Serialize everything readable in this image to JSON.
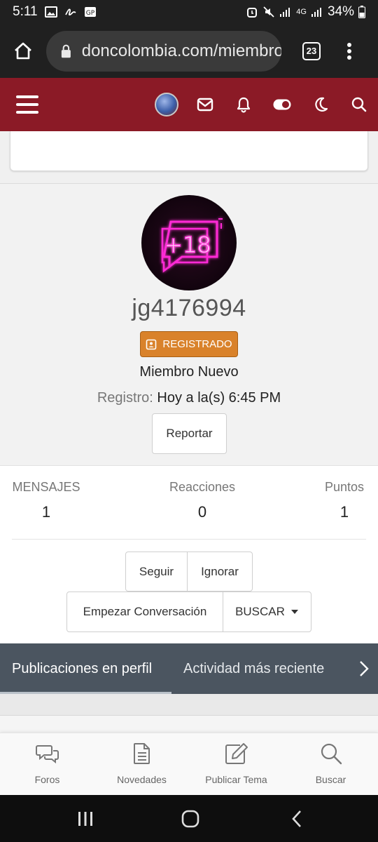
{
  "status_bar": {
    "time": "5:11",
    "battery": "34%",
    "network": "4G"
  },
  "browser": {
    "url": "doncolombia.com/miembros/",
    "tab_count": "23"
  },
  "profile": {
    "username": "jg4176994",
    "badge_label": "REGISTRADO",
    "member_title": "Miembro Nuevo",
    "registration_label": "Registro:",
    "registration_value": "Hoy a la(s) 6:45 PM",
    "report_label": "Reportar",
    "avatar_text": "+18"
  },
  "stats": [
    {
      "label": "MENSAJES",
      "value": "1"
    },
    {
      "label": "Reacciones",
      "value": "0"
    },
    {
      "label": "Puntos",
      "value": "1"
    }
  ],
  "actions": {
    "follow": "Seguir",
    "ignore": "Ignorar",
    "start_conversation": "Empezar Conversación",
    "search": "BUSCAR"
  },
  "tabs": [
    {
      "label": "Publicaciones en perfil",
      "active": true
    },
    {
      "label": "Actividad más reciente",
      "active": false
    }
  ],
  "bottom_nav": [
    {
      "label": "Foros",
      "icon": "chat-bubbles-icon"
    },
    {
      "label": "Novedades",
      "icon": "document-icon"
    },
    {
      "label": "Publicar Tema",
      "icon": "edit-icon"
    },
    {
      "label": "Buscar",
      "icon": "search-icon"
    }
  ],
  "colors": {
    "header": "#8b1a26",
    "badge": "#d9822b",
    "tab_bar": "#4b5560",
    "neon_pink": "#ff2bd6"
  }
}
